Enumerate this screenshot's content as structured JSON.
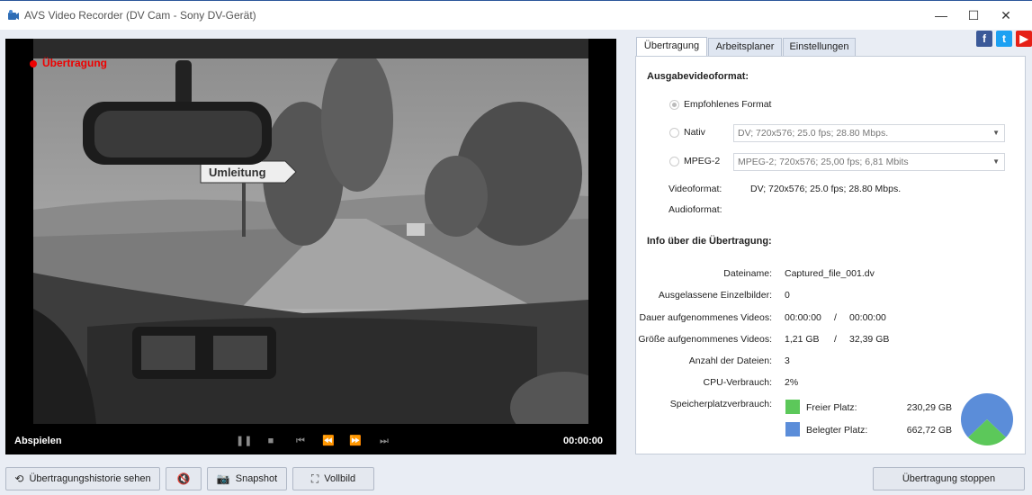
{
  "window": {
    "title": "AVS Video Recorder (DV Cam - Sony DV-Gerät)",
    "minimize": "—",
    "maximize": "☐",
    "close": "✕"
  },
  "video": {
    "live_label": "Übertragung",
    "play_label": "Abspielen",
    "timecode": "00:00:00",
    "controls": [
      "pause-icon",
      "stop-icon",
      "skip-back-icon",
      "rewind-icon",
      "fast-forward-icon",
      "skip-forward-icon"
    ],
    "road_sign": "Umleitung"
  },
  "social": {
    "facebook": "f",
    "twitter": "t",
    "youtube": "▶"
  },
  "tabs": [
    {
      "label": "Übertragung",
      "active": true
    },
    {
      "label": "Arbeitsplaner",
      "active": false
    },
    {
      "label": "Einstellungen",
      "active": false
    }
  ],
  "output_format": {
    "heading": "Ausgabevideoformat:",
    "recommended_label": "Empfohlenes Format",
    "native_label": "Nativ",
    "native_value": "DV; 720x576; 25.0 fps; 28.80 Mbps.",
    "mpeg2_label": "MPEG-2",
    "mpeg2_value": "MPEG-2; 720x576; 25,00 fps; 6,81 Mbits",
    "video_format_label": "Videoformat:",
    "video_format_value": "DV; 720x576; 25.0 fps; 28.80 Mbps.",
    "audio_format_label": "Audioformat:",
    "audio_format_value": ""
  },
  "info": {
    "heading": "Info über die Übertragung:",
    "filename_label": "Dateiname:",
    "filename_value": "Captured_file_001.dv",
    "dropped_label": "Ausgelassene Einzelbilder:",
    "dropped_value": "0",
    "duration_label": "Dauer aufgenommenes Videos:",
    "duration_value": "00:00:00",
    "duration_sep": "/",
    "duration_total": "00:00:00",
    "size_label": "Größe aufgenommenes Videos:",
    "size_value": "1,21 GB",
    "size_sep": "/",
    "size_total": "32,39 GB",
    "files_label": "Anzahl der Dateien:",
    "files_value": "3",
    "cpu_label": "CPU-Verbrauch:",
    "cpu_value": "2%",
    "storage_label": "Speicherplatzverbrauch:",
    "free_label": "Freier Platz:",
    "free_value": "230,29 GB",
    "used_label": "Belegter Platz:",
    "used_value": "662,72 GB",
    "colors": {
      "free": "#5cc85a",
      "used": "#5b8dd9"
    }
  },
  "bottom": {
    "history_label": "Übertragungshistorie sehen",
    "mute_icon": "mute-icon",
    "snapshot_label": "Snapshot",
    "fullscreen_label": "Vollbild",
    "stop_label": "Übertragung stoppen"
  }
}
